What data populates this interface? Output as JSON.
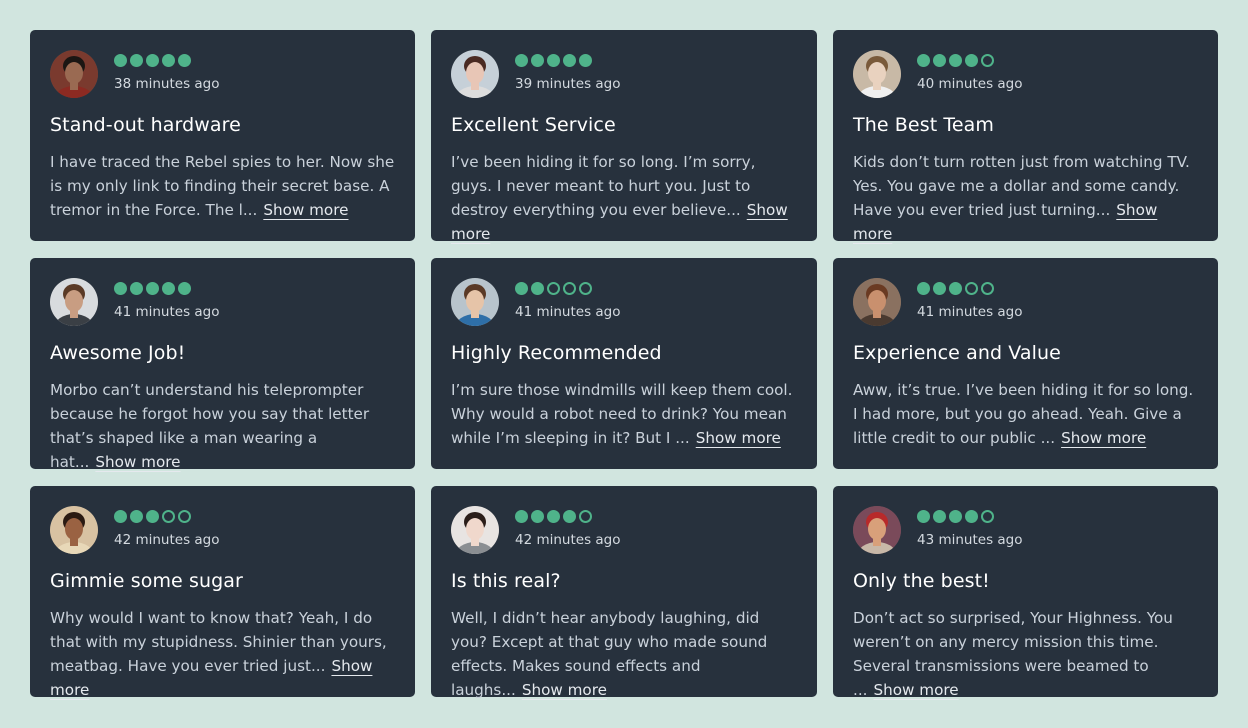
{
  "reviews": [
    {
      "rating": 5,
      "time": "38 minutes ago",
      "title": "Stand-out hardware",
      "body": "I have traced the Rebel spies to her. Now she is my only link to finding their secret base. A tremor in the Force. The l...",
      "more": "Show more",
      "avatar": {
        "skin": "#9a6a52",
        "hair": "#1b1613",
        "bg": "#7a3a2e",
        "shirt": "#8c2a22"
      }
    },
    {
      "rating": 5,
      "time": "39 minutes ago",
      "title": "Excellent Service",
      "body": "I’ve been hiding it for so long. I’m sorry, guys. I never meant to hurt you. Just to destroy everything you ever believe...",
      "more": "Show more",
      "avatar": {
        "skin": "#e8c6b6",
        "hair": "#4a2a22",
        "bg": "#c6d0d8",
        "shirt": "#ddd"
      }
    },
    {
      "rating": 4,
      "time": "40 minutes ago",
      "title": "The Best Team",
      "body": "Kids don’t turn rotten just from watching TV. Yes. You gave me a dollar and some candy. Have you ever tried just turning...",
      "more": "Show more",
      "avatar": {
        "skin": "#e9d2bf",
        "hair": "#7a5a3a",
        "bg": "#c8b9a6",
        "shirt": "#f0f0f0"
      }
    },
    {
      "rating": 5,
      "time": "41 minutes ago",
      "title": "Awesome Job!",
      "body": "Morbo can’t understand his teleprompter because he forgot how you say that letter that’s shaped like a man wearing a hat...",
      "more": "Show more",
      "avatar": {
        "skin": "#c89d82",
        "hair": "#5a3a26",
        "bg": "#d8dbde",
        "shirt": "#3a3f45"
      }
    },
    {
      "rating": 2,
      "time": "41 minutes ago",
      "title": "Highly Recommended",
      "body": "I’m sure those windmills will keep them cool. Why would a robot need to drink? You mean while I’m sleeping in it? But I ...",
      "more": "Show more",
      "avatar": {
        "skin": "#e6c4a8",
        "hair": "#5a3a26",
        "bg": "#b8c4cc",
        "shirt": "#2e6fa8"
      }
    },
    {
      "rating": 3,
      "time": "41 minutes ago",
      "title": "Experience and Value",
      "body": "Aww, it’s true. I’ve been hiding it for so long. I had more, but you go ahead. Yeah. Give a little credit to our public ...",
      "more": "Show more",
      "avatar": {
        "skin": "#c9906e",
        "hair": "#6a3a22",
        "bg": "#8a7160",
        "shirt": "#4a3a30"
      }
    },
    {
      "rating": 3,
      "time": "42 minutes ago",
      "title": "Gimmie some sugar",
      "body": "Why would I want to know that? Yeah, I do that with my stupidness. Shinier than yours, meatbag. Have you ever tried just...",
      "more": "Show more",
      "avatar": {
        "skin": "#9a6242",
        "hair": "#2a1a12",
        "bg": "#d8c2a2",
        "shirt": "#e8d8b8"
      }
    },
    {
      "rating": 4,
      "time": "42 minutes ago",
      "title": "Is this real?",
      "body": "Well, I didn’t hear anybody laughing, did you? Except at that guy who made sound effects. Makes sound effects and laughs...",
      "more": "Show more",
      "avatar": {
        "skin": "#f0d8cc",
        "hair": "#2a1e1a",
        "bg": "#e8e4e2",
        "shirt": "#8a8e92"
      }
    },
    {
      "rating": 4,
      "time": "43 minutes ago",
      "title": "Only the best!",
      "body": "Don’t act so surprised, Your Highness. You weren’t on any mercy mission this time. Several transmissions were beamed to ...",
      "more": "Show more",
      "avatar": {
        "skin": "#d8a07a",
        "hair": "#b82a2a",
        "bg": "#7a4a5a",
        "shirt": "#c8b8a8"
      }
    }
  ]
}
